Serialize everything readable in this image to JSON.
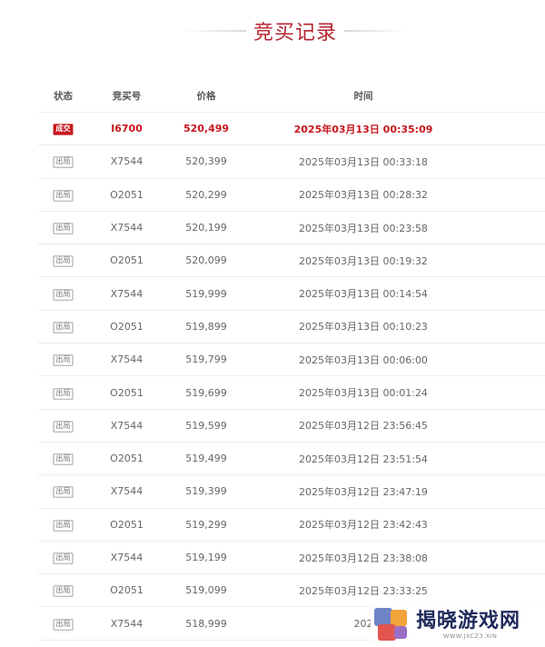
{
  "title": "竞买记录",
  "header": {
    "status": "状态",
    "code": "竞买号",
    "price": "价格",
    "time": "时间"
  },
  "rows": [
    {
      "status": "成交",
      "code": "I6700",
      "price": "520,499",
      "time": "2025年03月13日 00:35:09"
    },
    {
      "status": "出局",
      "code": "X7544",
      "price": "520,399",
      "time": "2025年03月13日 00:33:18"
    },
    {
      "status": "出局",
      "code": "O2051",
      "price": "520,299",
      "time": "2025年03月13日 00:28:32"
    },
    {
      "status": "出局",
      "code": "X7544",
      "price": "520,199",
      "time": "2025年03月13日 00:23:58"
    },
    {
      "status": "出局",
      "code": "O2051",
      "price": "520,099",
      "time": "2025年03月13日 00:19:32"
    },
    {
      "status": "出局",
      "code": "X7544",
      "price": "519,999",
      "time": "2025年03月13日 00:14:54"
    },
    {
      "status": "出局",
      "code": "O2051",
      "price": "519,899",
      "time": "2025年03月13日 00:10:23"
    },
    {
      "status": "出局",
      "code": "X7544",
      "price": "519,799",
      "time": "2025年03月13日 00:06:00"
    },
    {
      "status": "出局",
      "code": "O2051",
      "price": "519,699",
      "time": "2025年03月13日 00:01:24"
    },
    {
      "status": "出局",
      "code": "X7544",
      "price": "519,599",
      "time": "2025年03月12日 23:56:45"
    },
    {
      "status": "出局",
      "code": "O2051",
      "price": "519,499",
      "time": "2025年03月12日 23:51:54"
    },
    {
      "status": "出局",
      "code": "X7544",
      "price": "519,399",
      "time": "2025年03月12日 23:47:19"
    },
    {
      "status": "出局",
      "code": "O2051",
      "price": "519,299",
      "time": "2025年03月12日 23:42:43"
    },
    {
      "status": "出局",
      "code": "X7544",
      "price": "519,199",
      "time": "2025年03月12日 23:38:08"
    },
    {
      "status": "出局",
      "code": "O2051",
      "price": "519,099",
      "time": "2025年03月12日 23:33:25"
    },
    {
      "status": "出局",
      "code": "X7544",
      "price": "518,999",
      "time": "202"
    }
  ],
  "watermark": {
    "name": "揭晓游戏网",
    "url": "WWW.JXCZ3.XIN"
  },
  "colors": {
    "accent": "#c8161d",
    "title": "#b5242f",
    "text": "#666666"
  }
}
